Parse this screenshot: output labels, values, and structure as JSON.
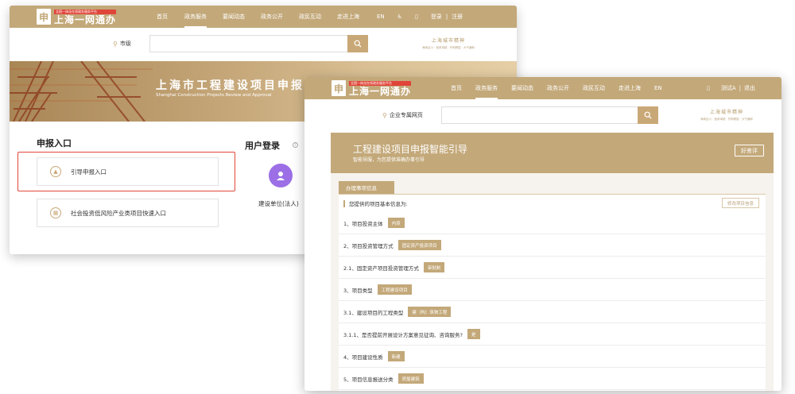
{
  "colors": {
    "brand": "#c3a879",
    "highlight": "#e2473a",
    "role_icon": "#9c6fe6"
  },
  "window1": {
    "logo": {
      "small": "全国一体化在线政务服务平台",
      "main": "上海一网通办",
      "mark": "申"
    },
    "nav": [
      "首页",
      "政务服务",
      "要闻动态",
      "政务公开",
      "政民互动",
      "走进上海",
      "EN",
      "♿",
      "▯",
      "登录",
      "|",
      "注册"
    ],
    "location": "市级",
    "search_placeholder": "",
    "brand": {
      "title": "上海城市精神",
      "sub": "海纳百川 · 追求卓越 · 开明睿智 · 大气谦和"
    },
    "banner": {
      "title": "上海市工程建设项目申报",
      "sub": "Shanghai Construction Projects Review and Approval"
    },
    "apply": {
      "title": "申报入口",
      "items": [
        "引导申报入口",
        "社会投资低风险产业类项目快速入口"
      ]
    },
    "login": {
      "title": "用户登录",
      "hint": "?",
      "role": "建设单位(法人)"
    }
  },
  "window2": {
    "logo": {
      "small": "全国一体化在线政务服务平台",
      "main": "上海一网通办",
      "mark": "申"
    },
    "nav": [
      "首页",
      "政务服务",
      "要闻动态",
      "政务公开",
      "政民互动",
      "走进上海",
      "EN"
    ],
    "user": [
      "▯",
      "测试A",
      "|",
      "退出"
    ],
    "location": "企业专属网页",
    "brand": {
      "title": "上海城市精神",
      "sub": "海纳百川 · 追求卓越 · 开明睿智 · 大气谦和"
    },
    "guide": {
      "title": "工程建设项目申报智能引导",
      "sub": "智能导服，为您提供准确办事引导",
      "button": "好差评"
    },
    "tab": "办理事项信息",
    "info_header": "您提供的项目基本信息为:",
    "edit_button": "修改项目信息",
    "rows": [
      {
        "label": "1、项目投资主体",
        "value": "内资"
      },
      {
        "label": "2、项目投资管理方式",
        "value": "固定资产投资项目"
      },
      {
        "label": "2.1、固定资产项目投资管理方式",
        "value": "审批制"
      },
      {
        "label": "3、项目类型",
        "value": "工程建设项目"
      },
      {
        "label": "3.1、建设项目的工程类型",
        "value": "建（构）筑物工程"
      },
      {
        "label": "3.1.1、是否提前开展设计方案意见征询、咨询服务?",
        "value": "是"
      },
      {
        "label": "4、项目建设性质",
        "value": "新建"
      },
      {
        "label": "5、项目信息报送分类",
        "value": "房屋建筑"
      }
    ]
  }
}
